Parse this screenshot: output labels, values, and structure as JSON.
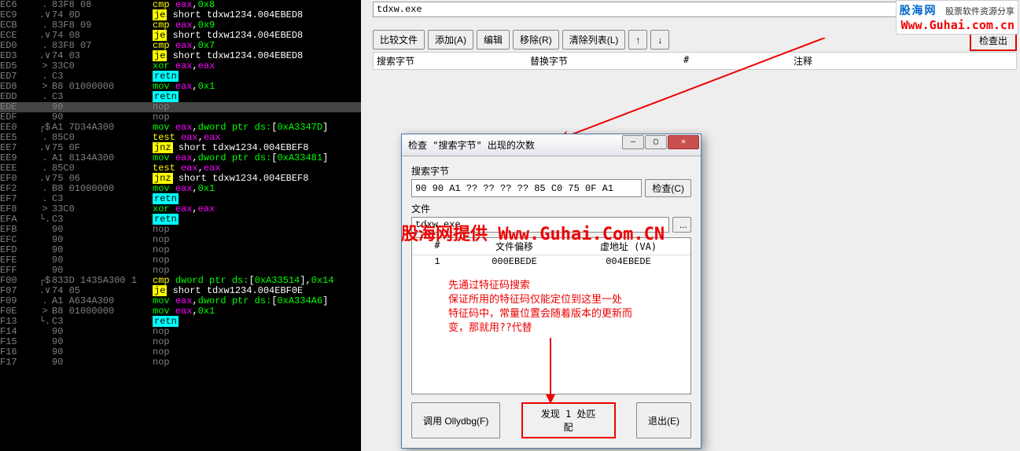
{
  "watermark": {
    "site_cn": "股海网",
    "site_tag": "股票软件资源分享",
    "url": "Www.Guhai.com.cn",
    "provided": "股海网提供 Www.Guhai.Com.CN"
  },
  "top_file": "tdxw.exe",
  "toolbar": {
    "compare": "比较文件",
    "add": "添加(A)",
    "edit": "编辑",
    "remove": "移除(R)",
    "clear": "清除列表(L)",
    "up": "↑",
    "down": "↓",
    "check": "检查出"
  },
  "table": {
    "h1": "搜索字节",
    "h2": "替换字节",
    "h3": "#",
    "h4": "注释"
  },
  "dialog": {
    "title": "检查 \"搜索字节\" 出现的次数",
    "label_search": "搜索字节",
    "search_value": "90 90 A1 ?? ?? ?? ?? 85 C0 75 0F A1",
    "btn_check": "检查(C)",
    "label_file": "文件",
    "file_value": "tdxw.exe",
    "file_btn": "...",
    "res_head": {
      "c1": "#",
      "c2": "文件偏移",
      "c3": "虚地址 (VA)"
    },
    "res_row": {
      "c1": "1",
      "c2": "000EBEDE",
      "c3": "004EBEDE"
    },
    "btn_olly": "调用 Ollydbg(F)",
    "found": "发现 1 处匹配",
    "btn_exit": "退出(E)",
    "win": {
      "min": "—",
      "max": "▢",
      "close": "✕"
    }
  },
  "anno": {
    "line1": "先通过特征码搜索",
    "line2": "保证所用的特征码仅能定位到这里一处",
    "line3": "特征码中，常量位置会随着版本的更新而",
    "line4": "变，那就用??代替"
  },
  "asm": [
    {
      "a": "EC6",
      "m": ".",
      "b": "83F8 08",
      "op": "cmp",
      "args": "eax,0x8"
    },
    {
      "a": "EC9",
      "m": ".∨",
      "b": "74 0D",
      "op": "je",
      "args": "short tdxw1234.004EBED8"
    },
    {
      "a": "ECB",
      "m": ".",
      "b": "83F8 09",
      "op": "cmp",
      "args": "eax,0x9"
    },
    {
      "a": "ECE",
      "m": ".∨",
      "b": "74 08",
      "op": "je",
      "args": "short tdxw1234.004EBED8"
    },
    {
      "a": "ED0",
      "m": ".",
      "b": "83F8 07",
      "op": "cmp",
      "args": "eax,0x7"
    },
    {
      "a": "ED3",
      "m": ".∨",
      "b": "74 03",
      "op": "je",
      "args": "short tdxw1234.004EBED8"
    },
    {
      "a": "ED5",
      "m": ">",
      "b": "33C0",
      "op": "xor",
      "args": "eax,eax"
    },
    {
      "a": "ED7",
      "m": ".",
      "b": "C3",
      "op": "retn",
      "args": ""
    },
    {
      "a": "ED8",
      "m": ">",
      "b": "B8 01000000",
      "op": "mov",
      "args": "eax,0x1"
    },
    {
      "a": "EDD",
      "m": ".",
      "b": "C3",
      "op": "retn",
      "args": ""
    },
    {
      "a": "EDE",
      "m": "",
      "b": "90",
      "op": "nop",
      "args": "",
      "hl": true
    },
    {
      "a": "EDF",
      "m": "",
      "b": "90",
      "op": "nop",
      "args": ""
    },
    {
      "a": "EE0",
      "m": "┌$",
      "b": "A1 7D34A300",
      "op": "mov",
      "args": "eax,dword ptr ds:[0xA3347D]"
    },
    {
      "a": "EE5",
      "m": ".",
      "b": "85C0",
      "op": "test",
      "args": "eax,eax"
    },
    {
      "a": "EE7",
      "m": ".∨",
      "b": "75 0F",
      "op": "jnz",
      "args": "short tdxw1234.004EBEF8"
    },
    {
      "a": "EE9",
      "m": ".",
      "b": "A1 8134A300",
      "op": "mov",
      "args": "eax,dword ptr ds:[0xA33481]"
    },
    {
      "a": "EEE",
      "m": ".",
      "b": "85C0",
      "op": "test",
      "args": "eax,eax"
    },
    {
      "a": "EF0",
      "m": ".∨",
      "b": "75 06",
      "op": "jnz",
      "args": "short tdxw1234.004EBEF8"
    },
    {
      "a": "EF2",
      "m": ".",
      "b": "B8 01000000",
      "op": "mov",
      "args": "eax,0x1"
    },
    {
      "a": "EF7",
      "m": ".",
      "b": "C3",
      "op": "retn",
      "args": ""
    },
    {
      "a": "EF8",
      "m": ">",
      "b": "33C0",
      "op": "xor",
      "args": "eax,eax"
    },
    {
      "a": "EFA",
      "m": "└.",
      "b": "C3",
      "op": "retn",
      "args": ""
    },
    {
      "a": "EFB",
      "m": "",
      "b": "90",
      "op": "nop",
      "args": ""
    },
    {
      "a": "EFC",
      "m": "",
      "b": "90",
      "op": "nop",
      "args": ""
    },
    {
      "a": "EFD",
      "m": "",
      "b": "90",
      "op": "nop",
      "args": ""
    },
    {
      "a": "EFE",
      "m": "",
      "b": "90",
      "op": "nop",
      "args": ""
    },
    {
      "a": "EFF",
      "m": "",
      "b": "90",
      "op": "nop",
      "args": ""
    },
    {
      "a": "F00",
      "m": "┌$",
      "b": "833D 1435A300 1",
      "op": "cmp",
      "args": "dword ptr ds:[0xA33514],0x14"
    },
    {
      "a": "F07",
      "m": ".∨",
      "b": "74 05",
      "op": "je",
      "args": "short tdxw1234.004EBF0E"
    },
    {
      "a": "F09",
      "m": ".",
      "b": "A1 A634A300",
      "op": "mov",
      "args": "eax,dword ptr ds:[0xA334A6]"
    },
    {
      "a": "F0E",
      "m": ">",
      "b": "B8 01000000",
      "op": "mov",
      "args": "eax,0x1"
    },
    {
      "a": "F13",
      "m": "└.",
      "b": "C3",
      "op": "retn",
      "args": ""
    },
    {
      "a": "F14",
      "m": "",
      "b": "90",
      "op": "nop",
      "args": ""
    },
    {
      "a": "F15",
      "m": "",
      "b": "90",
      "op": "nop",
      "args": ""
    },
    {
      "a": "F16",
      "m": "",
      "b": "90",
      "op": "nop",
      "args": ""
    },
    {
      "a": "F17",
      "m": "",
      "b": "90",
      "op": "nop",
      "args": ""
    }
  ]
}
